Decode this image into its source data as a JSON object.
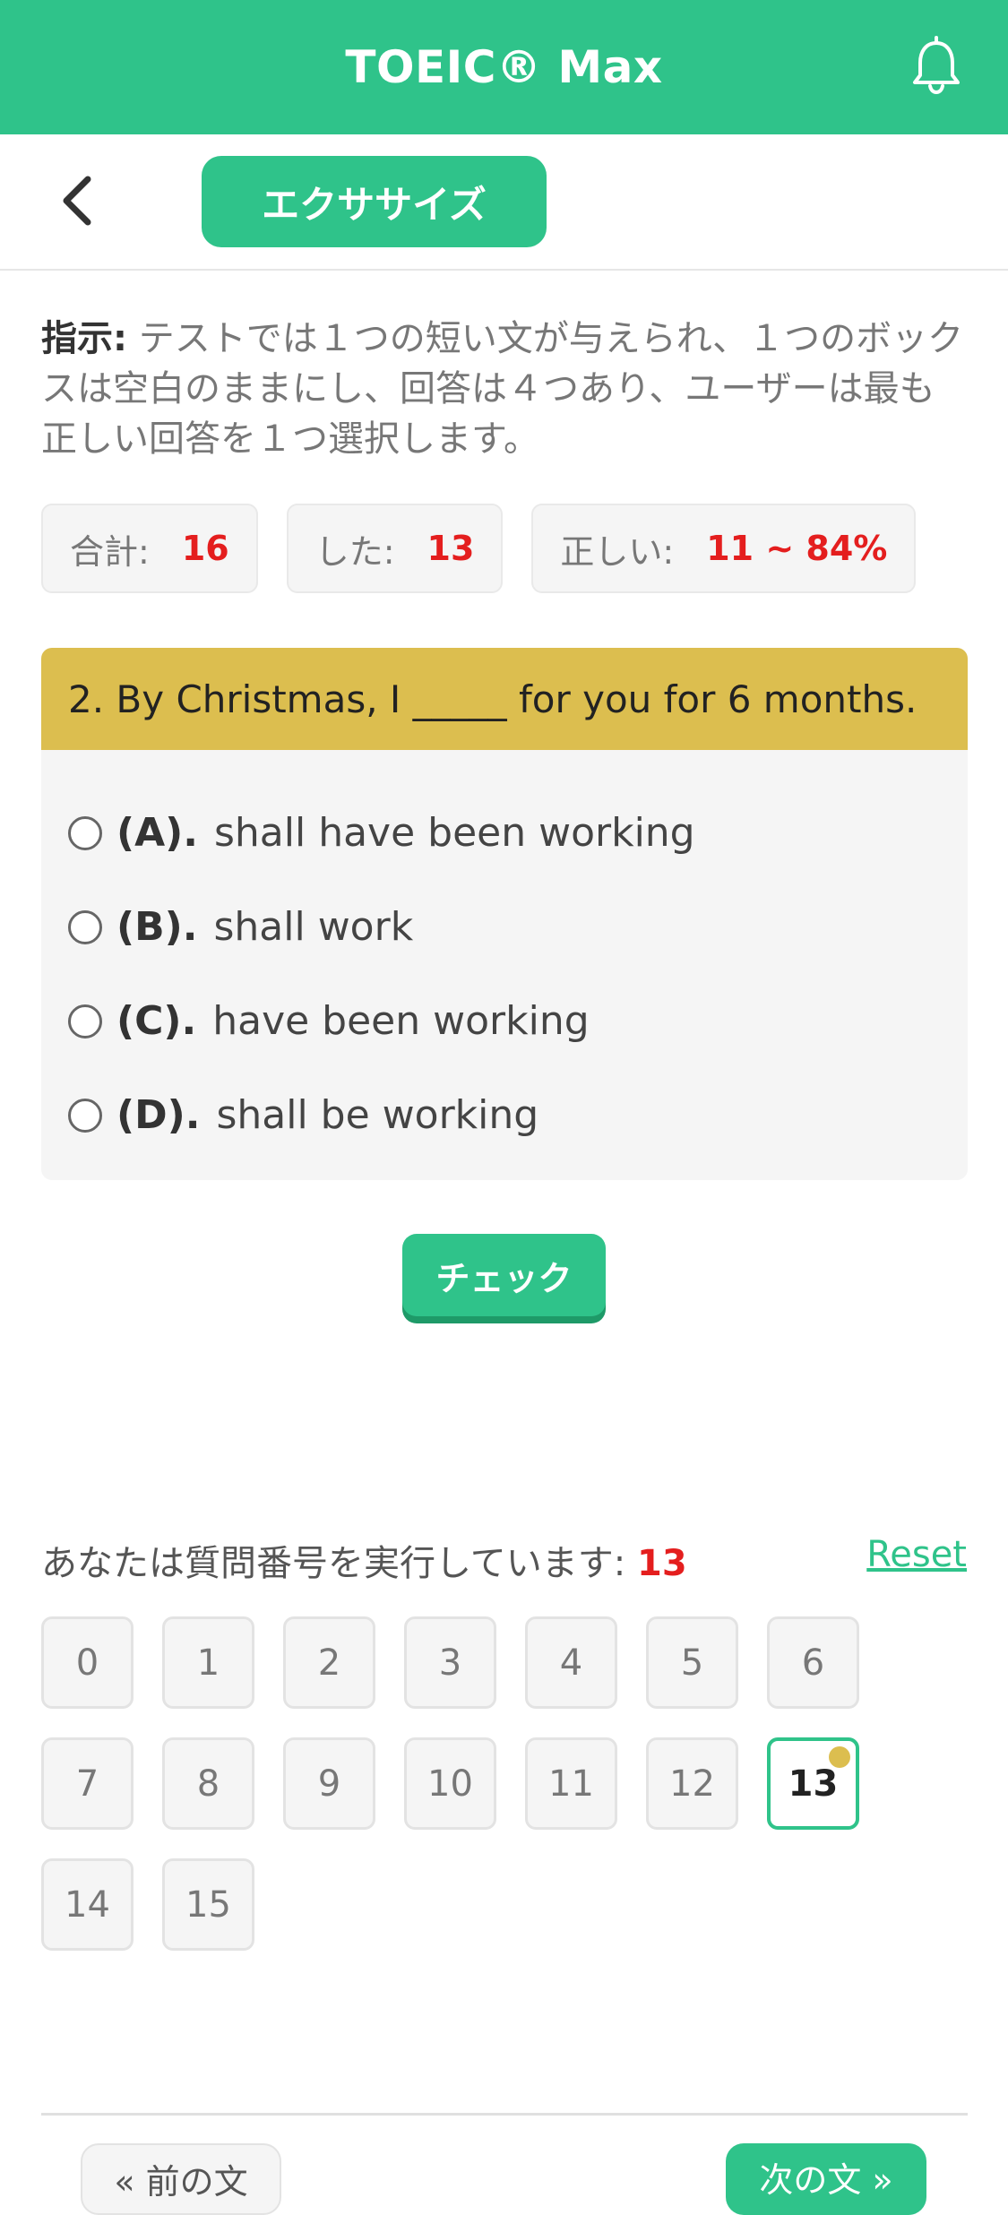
{
  "header": {
    "title": "TOEIC® Max",
    "bell_icon": "bell-icon"
  },
  "subbar": {
    "back_icon": "chevron-left-icon",
    "tab_label": "エクササイズ"
  },
  "instructions": {
    "label": "指示:",
    "text": " テストでは１つの短い文が与えられ、１つのボックスは空白のままにし、回答は４つあり、ユーザーは最も正しい回答を１つ選択します。"
  },
  "stats": {
    "total_label": "合計:",
    "total_value": "16",
    "done_label": "した:",
    "done_value": "13",
    "correct_label": "正しい:",
    "correct_value": "11 ~ 84%"
  },
  "question": {
    "text": "2. By Christmas, I _____ for you for 6 months.",
    "options": [
      {
        "key": "(A).",
        "text": "shall have been working"
      },
      {
        "key": "(B).",
        "text": "shall work"
      },
      {
        "key": "(C).",
        "text": "have been working"
      },
      {
        "key": "(D).",
        "text": "shall be working"
      }
    ]
  },
  "check_label": "チェック",
  "progress": {
    "label": "あなたは質問番号を実行しています:",
    "current": "13",
    "reset_label": "Reset",
    "numbers": [
      "0",
      "1",
      "2",
      "3",
      "4",
      "5",
      "6",
      "7",
      "8",
      "9",
      "10",
      "11",
      "12",
      "13",
      "14",
      "15"
    ],
    "active_index": 13
  },
  "footer": {
    "prev_label": "« 前の文",
    "next_label": "次の文 »"
  },
  "colors": {
    "brand": "#2fc38a",
    "question_header": "#dcbe4f",
    "highlight": "#e41e1e"
  }
}
